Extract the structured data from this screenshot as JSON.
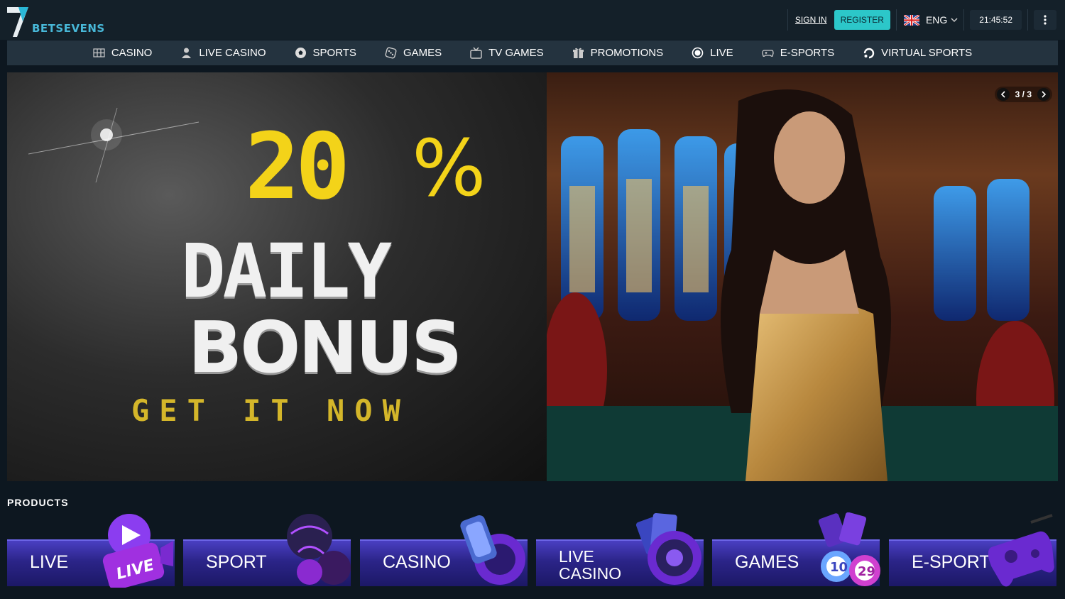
{
  "brand": {
    "name": "BETSEVENS"
  },
  "header": {
    "signin_label": "SIGN IN",
    "register_label": "REGISTER",
    "language": "ENG",
    "time": "21:45:52"
  },
  "nav": {
    "items": [
      {
        "label": "CASINO",
        "icon": "grid-icon"
      },
      {
        "label": "LIVE CASINO",
        "icon": "dealer-icon"
      },
      {
        "label": "SPORTS",
        "icon": "soccer-ball-icon"
      },
      {
        "label": "GAMES",
        "icon": "dice-icon"
      },
      {
        "label": "TV GAMES",
        "icon": "tv-icon"
      },
      {
        "label": "PROMOTIONS",
        "icon": "gift-icon"
      },
      {
        "label": "LIVE",
        "icon": "live-dot-icon"
      },
      {
        "label": "E-SPORTS",
        "icon": "gamepad-icon"
      },
      {
        "label": "VIRTUAL SPORTS",
        "icon": "virtual-sports-icon"
      }
    ]
  },
  "banner": {
    "percent": "20",
    "percent_sign": "%",
    "line1": "DAILY",
    "line2": "BONUS",
    "cta": "GET IT NOW",
    "pager": "3 / 3"
  },
  "products": {
    "title": "PRODUCTS",
    "items": [
      {
        "label": "LIVE"
      },
      {
        "label": "SPORT"
      },
      {
        "label": "CASINO"
      },
      {
        "label_line1": "LIVE",
        "label_line2": "CASINO"
      },
      {
        "label": "GAMES"
      },
      {
        "label": "E-SPORTS"
      }
    ],
    "badge_live": "LIVE",
    "badge_numbers": [
      "10",
      "29"
    ]
  },
  "colors": {
    "accent": "#2cc7c9",
    "bonus_yellow": "#f3d319",
    "product_purple": "#2b2488"
  }
}
